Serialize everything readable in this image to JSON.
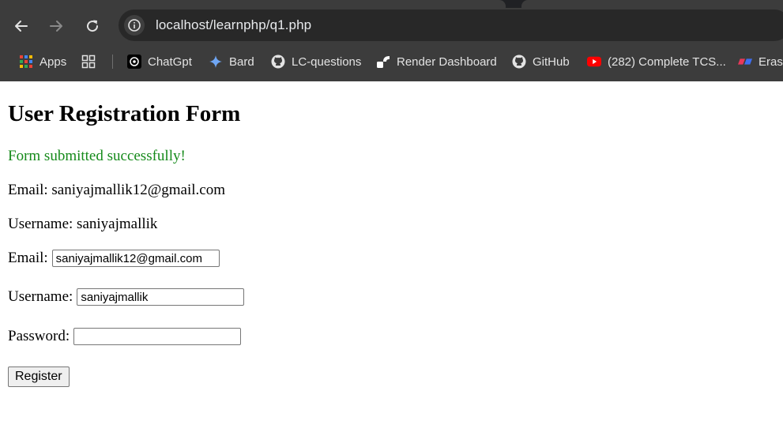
{
  "browser": {
    "url": "localhost/learnphp/q1.php",
    "bookmarks": [
      {
        "label": "Apps",
        "icon": "apps-grid-icon"
      },
      {
        "label": "",
        "icon": "tab-groups-icon"
      },
      {
        "label": "ChatGpt",
        "icon": "chatgpt-icon"
      },
      {
        "label": "Bard",
        "icon": "bard-sparkle-icon"
      },
      {
        "label": "LC-questions",
        "icon": "github-icon"
      },
      {
        "label": "Render Dashboard",
        "icon": "render-icon"
      },
      {
        "label": "GitHub",
        "icon": "github-icon"
      },
      {
        "label": "(282) Complete TCS...",
        "icon": "youtube-icon"
      },
      {
        "label": "Erase",
        "icon": "eraser-icon"
      }
    ]
  },
  "page": {
    "title": "User Registration Form",
    "success_message": "Form submitted successfully!",
    "submitted_email": "Email: saniyajmallik12@gmail.com",
    "submitted_username": "Username: saniyajmallik",
    "form": {
      "email_label": "Email:",
      "email_value": "saniyajmallik12@gmail.com",
      "username_label": "Username:",
      "username_value": "saniyajmallik",
      "password_label": "Password:",
      "password_value": "",
      "submit_label": "Register"
    }
  },
  "colors": {
    "chrome_bg": "#3c3c3c",
    "omnibox_bg": "#282828",
    "success_green": "#158a1a"
  }
}
